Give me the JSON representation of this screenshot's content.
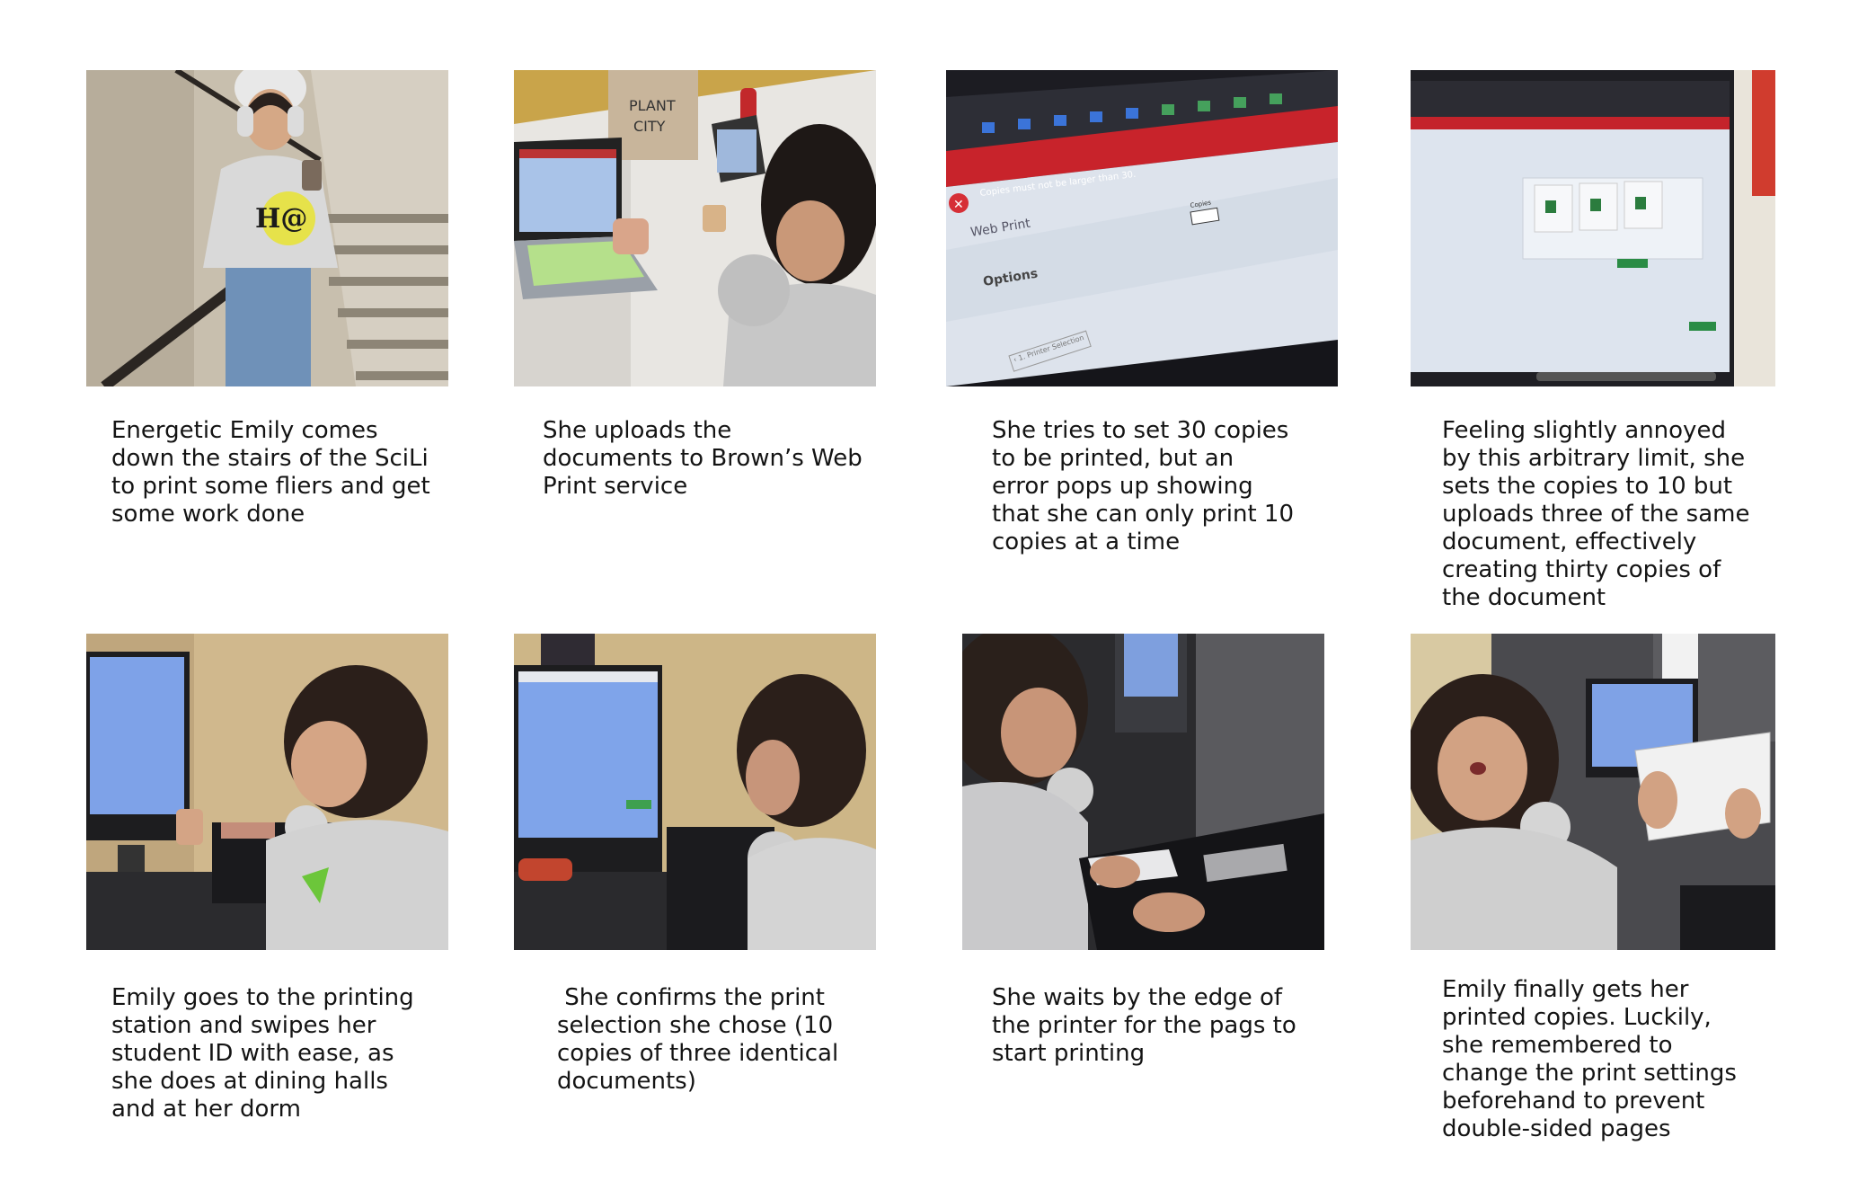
{
  "panels": [
    {
      "caption": "Energetic Emily comes down the stairs of the SciLi to print some fliers and get some work done"
    },
    {
      "caption": "She uploads the documents to Brown’s Web Print service",
      "bag_line1": "PLANT",
      "bag_line2": "CITY"
    },
    {
      "caption": "She tries to set 30 copies to be printed, but an error pops up showing that she can only print 10 copies at a time",
      "error_text": "Copies must not be larger than 30.",
      "web_print": "Web Print",
      "options": "Options",
      "copies_label": "Copies",
      "printer_btn": "‹ 1. Printer Selection"
    },
    {
      "caption": "Feeling slightly annoyed by this arbitrary limit, she sets the copies to 10 but uploads three of the same document, effectively creating thirty copies of the document"
    },
    {
      "caption": "Emily goes to the printing station and swipes her student ID with ease, as she does at dining halls and at her dorm"
    },
    {
      "caption": " She confirms the print selection she chose (10 copies of three identical documents)"
    },
    {
      "caption": "She waits by the edge of the printer for the pags to start printing"
    },
    {
      "caption": "Emily finally gets her printed copies. Luckily, she remembered to change the print settings beforehand to prevent double-sided pages"
    }
  ]
}
